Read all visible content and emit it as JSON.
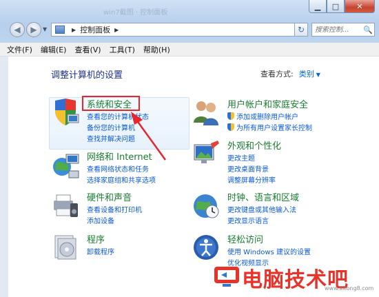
{
  "window": {
    "ghost_title": "win7截图 · 控制面板",
    "controls": {
      "minimize": "▁",
      "maximize": "□",
      "close": "✕"
    }
  },
  "nav": {
    "back": "◀",
    "forward": "▶",
    "breadcrumb_root_sep": "▶",
    "breadcrumb": "控制面板",
    "breadcrumb_sep": "▶",
    "dropdown": "▼",
    "refresh": "↻",
    "search_placeholder": "搜索控制...",
    "search_icon": "🔍"
  },
  "menu": [
    "文件(F)",
    "编辑(E)",
    "查看(V)",
    "工具(T)",
    "帮助(H)"
  ],
  "page": {
    "title": "调整计算机的设置",
    "view_by_label": "查看方式:",
    "view_by_value": "类别",
    "view_by_caret": "▼"
  },
  "categories": [
    {
      "title": "系统和安全",
      "icon": "shield-computer-icon",
      "links": [
        "查看您的计算机状态",
        "备份您的计算机",
        "查找并解决问题"
      ]
    },
    {
      "title": "用户帐户和家庭安全",
      "icon": "users-icon",
      "links": [
        "添加或删除用户帐户",
        "为所有用户设置家长控制"
      ]
    },
    {
      "title": "网络和 Internet",
      "icon": "network-globe-icon",
      "links": [
        "查看网络状态和任务",
        "选择家庭组和共享选项"
      ]
    },
    {
      "title": "外观和个性化",
      "icon": "monitor-brush-icon",
      "links": [
        "更改主题",
        "更改桌面背景",
        "调整屏幕分辨率"
      ]
    },
    {
      "title": "硬件和声音",
      "icon": "printer-speaker-icon",
      "links": [
        "查看设备和打印机",
        "添加设备"
      ]
    },
    {
      "title": "时钟、语言和区域",
      "icon": "clock-globe-icon",
      "links": [
        "更改键盘或其他输入法",
        "更改显示语言"
      ]
    },
    {
      "title": "程序",
      "icon": "programs-disc-icon",
      "links": [
        "卸载程序"
      ]
    },
    {
      "title": "轻松访问",
      "icon": "ease-of-access-icon",
      "links": [
        "使用 Windows 建议的设置",
        "优化视频显示"
      ]
    }
  ],
  "watermark": {
    "text": "电脑技术吧",
    "url": "www.xitong8.com"
  },
  "colors": {
    "category_title": "#1a7d30",
    "link": "#0b5ad4",
    "page_title": "#1e3287",
    "annotation": "#e8252b"
  }
}
